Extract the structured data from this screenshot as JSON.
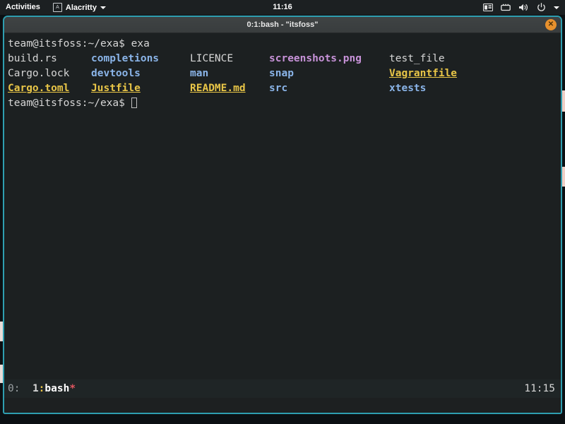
{
  "topbar": {
    "activities": "Activities",
    "app_name": "Alacritty",
    "app_icon": "alacritty-icon",
    "clock": "11:16",
    "tray_icons": [
      {
        "name": "keyboard-layout-icon"
      },
      {
        "name": "network-wired-icon"
      },
      {
        "name": "volume-icon"
      },
      {
        "name": "power-icon"
      },
      {
        "name": "chevron-down-icon"
      }
    ]
  },
  "window": {
    "title": "0:1:bash - \"itsfoss\"",
    "close_label": "✕",
    "border_color": "#2e9eb0"
  },
  "terminal": {
    "prompt": "team@itsfoss:~/exa$",
    "command": " exa",
    "colors": {
      "background": "#1c2021",
      "foreground": "#d6d6d6",
      "directory": "#8ab4e8",
      "image": "#c792d8",
      "config": "#e8c547",
      "cursor": "#bfbfbf"
    },
    "listing_rows": [
      [
        {
          "name": "build.rs",
          "type": "file"
        },
        {
          "name": "completions",
          "type": "dir"
        },
        {
          "name": "LICENCE",
          "type": "file"
        },
        {
          "name": "screenshots.png",
          "type": "image"
        },
        {
          "name": "test_file",
          "type": "file"
        }
      ],
      [
        {
          "name": "Cargo.lock",
          "type": "file"
        },
        {
          "name": "devtools",
          "type": "dir"
        },
        {
          "name": "man",
          "type": "dir"
        },
        {
          "name": "snap",
          "type": "dir"
        },
        {
          "name": "Vagrantfile",
          "type": "config"
        }
      ],
      [
        {
          "name": "Cargo.toml",
          "type": "config"
        },
        {
          "name": "Justfile",
          "type": "config"
        },
        {
          "name": "README.md",
          "type": "config"
        },
        {
          "name": "src",
          "type": "dir"
        },
        {
          "name": "xtests",
          "type": "dir"
        }
      ]
    ]
  },
  "tmux_status": {
    "session": "0:",
    "window_index": "1",
    "separator": ":",
    "window_name": "bash",
    "window_flag": "*",
    "clock": "11:15"
  }
}
